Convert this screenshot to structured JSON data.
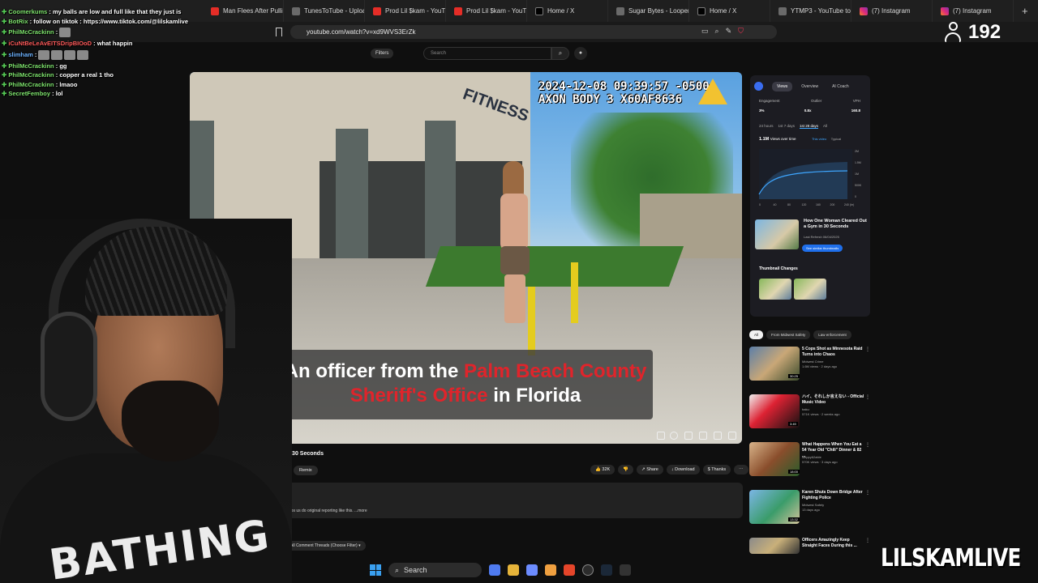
{
  "browser": {
    "tabs": [
      {
        "label": "Man Flees After Pulling",
        "kind": "yt"
      },
      {
        "label": "TunesToTube - Upload F",
        "kind": "gen"
      },
      {
        "label": "Prod Lil $kam - YouTube",
        "kind": "yt"
      },
      {
        "label": "Prod Lil $kam - YouTube",
        "kind": "yt"
      },
      {
        "label": "Home / X",
        "kind": "x"
      },
      {
        "label": "Sugar Bytes - Loopera",
        "kind": "gen"
      },
      {
        "label": "Home / X",
        "kind": "x"
      },
      {
        "label": "YTMP3 - YouTube to MP",
        "kind": "gen"
      },
      {
        "label": "(7) Instagram",
        "kind": "ig"
      },
      {
        "label": "(7) Instagram",
        "kind": "ig"
      }
    ],
    "new_tab": "+",
    "url": "youtube.com/watch?v=xd9WVS3ErZk"
  },
  "stream": {
    "viewer_count": "192",
    "channel_name": "LILSKAMLIVE"
  },
  "chat": [
    {
      "user": "Coomerkums",
      "msg": "my balls are low and full like that they just is",
      "color": "g"
    },
    {
      "user": "BotRix",
      "msg": "follow on tiktok : https://www.tiktok.com/@lilskamlive",
      "color": "g"
    },
    {
      "user": "PhilMcCrackinn",
      "msg": "",
      "color": "g",
      "emotes": 1
    },
    {
      "user": "iCuNtBeLeAvEITSDripBIOoD",
      "msg": "what happin",
      "color": "r"
    },
    {
      "user": "slimham",
      "msg": "",
      "color": "b",
      "emotes": 4
    },
    {
      "user": "PhilMcCrackinn",
      "msg": "gg",
      "color": "g"
    },
    {
      "user": "PhilMcCrackinn",
      "msg": "copper a real 1 tho",
      "color": "g"
    },
    {
      "user": "PhilMcCrackinn",
      "msg": "lmaoo",
      "color": "g"
    },
    {
      "user": "SecretFemboy",
      "msg": "lol",
      "color": "g"
    }
  ],
  "youtube": {
    "filters_label": "Filters",
    "search_placeholder": "Search",
    "video": {
      "osd_line1": "2024-12-08 09:39:57 -0500",
      "osd_line2": "AXON BODY 3 X60AF8636",
      "caption_part1": "An officer from the ",
      "caption_red1": "Palm Beach County",
      "caption_red2": "Sheriff's Office",
      "caption_part2": " in Florida",
      "storefront_text": "FITNESS",
      "title": "ut a Gym in 30 Seconds",
      "remix_label": "Remix",
      "likes": "32K",
      "share_label": "Share",
      "download_label": "Download",
      "thanks_label": "Thanks",
      "description": "helps us do original reporting like this. ...more",
      "threads_label": "All Comment Threads (Choose Filter)"
    },
    "analytics": {
      "tabs": [
        "Views",
        "Overview",
        "AI Coach"
      ],
      "stats": [
        {
          "label": "Engagement",
          "value": "3%"
        },
        {
          "label": "Outlier",
          "value": "0.8x"
        },
        {
          "label": "VPH",
          "value": "160.8"
        }
      ],
      "ranges": [
        "24 hours",
        "1st 7 days",
        "1st 28 days",
        "All"
      ],
      "views_total": "1.1M",
      "views_over_time": "Views over time",
      "legend": [
        "This video",
        "Typical"
      ],
      "chart_y_ticks": [
        "2M",
        "1.5M",
        "1M",
        "500K",
        "0"
      ],
      "chart_x_ticks": [
        "0",
        "40",
        "80",
        "120",
        "160",
        "200",
        "240 (hr)"
      ],
      "recommended_title": "How One Woman Cleared Out a Gym in 30 Seconds",
      "recommended_meta": "Last Refresh 06/04/2025",
      "recommended_button": "See similar thumbnails",
      "thumbnail_changes": "Thumbnail Changes"
    },
    "chips": [
      "All",
      "From Midwest Safety",
      "Law enforcement"
    ],
    "recommendations": [
      {
        "title": "5 Cops Shot as Minnesota Raid Turns into Chaos",
        "channel": "Midwest Crime",
        "meta": "1.6M views · 2 days ago",
        "duration": "30:25"
      },
      {
        "title": "ハイ、それしか言えない - Official Music Video",
        "channel": "baku",
        "meta": "571K views · 2 weeks ago",
        "duration": "3:49"
      },
      {
        "title": "What Happens When You Eat a 54 Year Old \"Chili\" Dinner & 82 ...",
        "channel": "steppy62able",
        "meta": "570K views · 3 days ago",
        "duration": "18:00"
      },
      {
        "title": "Karen Shuts Down Bridge After Fighting Police",
        "channel": "Midwest Safety",
        "meta": "13 days ago",
        "duration": "13:32"
      },
      {
        "title": "Officers Amazingly Keep Straight Faces During this ...",
        "channel": "",
        "meta": "",
        "duration": ""
      }
    ]
  },
  "taskbar": {
    "search_label": "Search"
  },
  "webcam": {
    "shirt_text": "BATHING"
  }
}
